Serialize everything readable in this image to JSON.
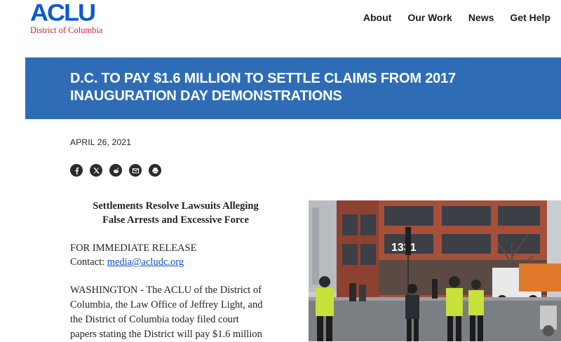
{
  "header": {
    "logo_text": "ACLU",
    "logo_subtitle": "District of Columbia",
    "nav": [
      "About",
      "Our Work",
      "News",
      "Get Help"
    ]
  },
  "article": {
    "title": "D.C. TO PAY $1.6 MILLION TO SETTLE CLAIMS FROM 2017 INAUGURATION DAY DEMONSTRATIONS",
    "date": "APRIL 26, 2021",
    "share_icons": [
      "facebook-icon",
      "x-icon",
      "reddit-icon",
      "email-icon",
      "print-icon"
    ],
    "subhead_line1": "Settlements Resolve Lawsuits Alleging",
    "subhead_line2": "False Arrests and Excessive Force",
    "release_label": "FOR IMMEDIATE RELEASE",
    "contact_label": "Contact:",
    "contact_email": "media@acludc.org",
    "body_line1": "WASHINGTON - The ACLU of the District of",
    "body_line2": "Columbia, the Law Office of Jeffrey Light, and",
    "body_line3": "the District of Columbia today filed court",
    "body_line4": "papers stating the District will pay $1.6 million",
    "photo_building_number": "1331"
  },
  "colors": {
    "brand_blue": "#0a5ad5",
    "brand_red": "#d2232a",
    "banner_blue": "#2e6db5"
  }
}
